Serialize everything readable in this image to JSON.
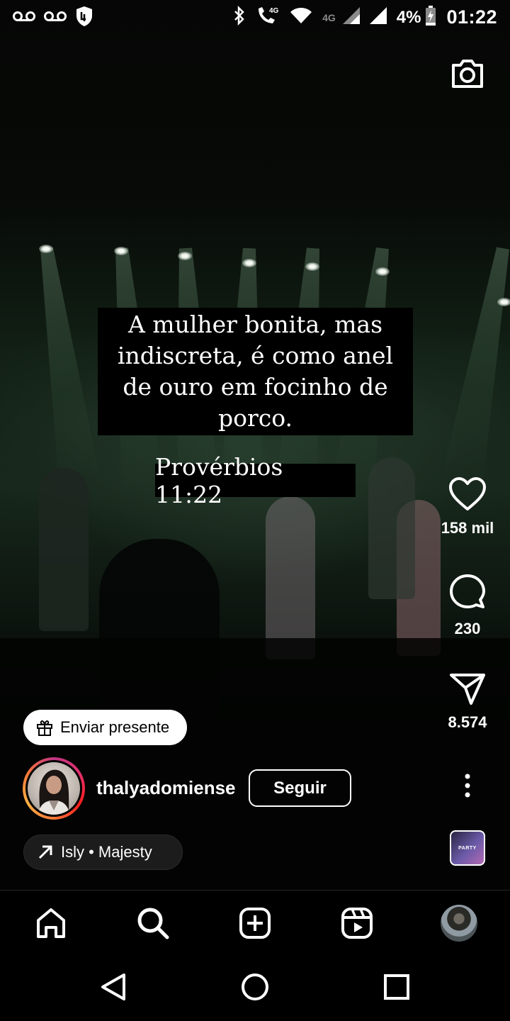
{
  "status_bar": {
    "network_label": "4G",
    "battery": "4%",
    "time": "01:22",
    "icons": [
      "voicemail-icon",
      "voicemail-icon",
      "vpn-shield-icon",
      "bluetooth-icon",
      "volte-call-icon",
      "wifi-icon",
      "signal-icon",
      "signal-icon",
      "battery-charging-icon"
    ]
  },
  "top_bar": {
    "camera_icon": "camera-icon"
  },
  "caption": {
    "text": "A mulher bonita, mas indiscreta, é como anel de ouro em focinho de porco.",
    "reference": "Provérbios 11:22"
  },
  "actions": {
    "like_count": "158 mil",
    "comment_count": "230",
    "share_count": "8.574"
  },
  "gift_button": {
    "label": "Enviar presente",
    "icon": "gift-icon"
  },
  "author": {
    "username": "thalyadomiense",
    "follow_label": "Seguir"
  },
  "audio": {
    "label": "Isly • Majesty",
    "thumb_text": "PARTY"
  },
  "bottom_nav": {
    "items": [
      "home-icon",
      "search-icon",
      "create-icon",
      "reels-icon",
      "profile-avatar"
    ]
  },
  "system_nav": [
    "back-icon",
    "home-circle-icon",
    "recents-icon"
  ],
  "colors": {
    "background": "#000000",
    "text": "#ffffff",
    "pill": "#ffffff"
  }
}
